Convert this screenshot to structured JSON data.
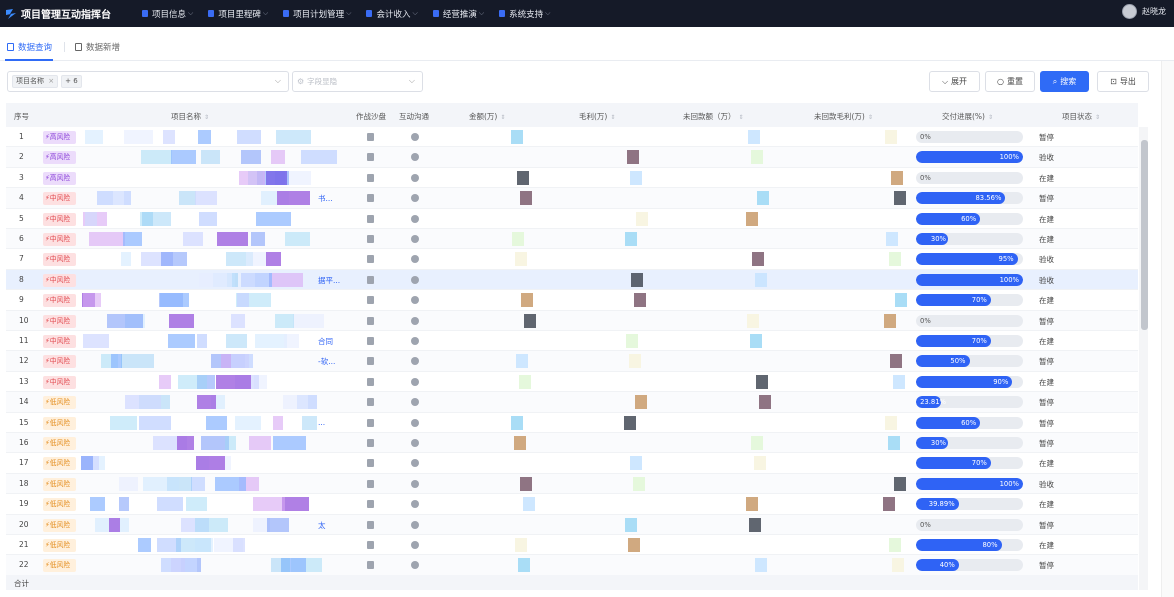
{
  "app": {
    "title": "项目管理互动指挥台"
  },
  "nav": [
    {
      "label": "项目信息"
    },
    {
      "label": "项目里程碑"
    },
    {
      "label": "项目计划管理"
    },
    {
      "label": "会计收入"
    },
    {
      "label": "经营推演"
    },
    {
      "label": "系统支持"
    }
  ],
  "user": {
    "name": "赵晓龙"
  },
  "tabs": [
    {
      "label": "数据查询"
    },
    {
      "label": "数据新增"
    }
  ],
  "filters": {
    "chip1": "项目名称",
    "chip_close": "×",
    "chip2": "+ 6",
    "field_placeholder": "字段显隐"
  },
  "buttons": {
    "expand": "展开",
    "reset": "重置",
    "search": "搜索",
    "export": "导出"
  },
  "columns": {
    "index": "序号",
    "name": "项目名称",
    "sandbox": "作战沙盘",
    "comm": "互动沟通",
    "amount": "金额(万)",
    "margin": "毛利(万)",
    "future_amount": "未回款额（万）",
    "future_margin": "未回款毛利(万)",
    "progress": "交付进展(%)",
    "status": "项目状态"
  },
  "rows": [
    {
      "index": "1",
      "risk": "高风险",
      "level": "high",
      "progress_label": "0%",
      "progress": 0,
      "status": "暂停",
      "name_suffix": ""
    },
    {
      "index": "2",
      "risk": "高风险",
      "level": "high",
      "progress_label": "100%",
      "progress": 100,
      "status": "验收",
      "name_suffix": ""
    },
    {
      "index": "3",
      "risk": "高风险",
      "level": "high",
      "progress_label": "0%",
      "progress": 0,
      "status": "在建",
      "name_suffix": ""
    },
    {
      "index": "4",
      "risk": "中风险",
      "level": "mid",
      "progress_label": "83.56%",
      "progress": 83.56,
      "status": "暂停",
      "name_suffix": "书..."
    },
    {
      "index": "5",
      "risk": "中风险",
      "level": "mid",
      "progress_label": "60%",
      "progress": 60,
      "status": "在建",
      "name_suffix": ""
    },
    {
      "index": "6",
      "risk": "中风险",
      "level": "mid",
      "progress_label": "30%",
      "progress": 30,
      "status": "在建",
      "name_suffix": ""
    },
    {
      "index": "7",
      "risk": "中风险",
      "level": "mid",
      "progress_label": "95%",
      "progress": 95,
      "status": "验收",
      "name_suffix": ""
    },
    {
      "index": "8",
      "risk": "中风险",
      "level": "mid",
      "progress_label": "100%",
      "progress": 100,
      "status": "验收",
      "name_suffix": "据平..."
    },
    {
      "index": "9",
      "risk": "中风险",
      "level": "mid",
      "progress_label": "70%",
      "progress": 70,
      "status": "在建",
      "name_suffix": ""
    },
    {
      "index": "10",
      "risk": "中风险",
      "level": "mid",
      "progress_label": "0%",
      "progress": 0,
      "status": "暂停",
      "name_suffix": ""
    },
    {
      "index": "11",
      "risk": "中风险",
      "level": "mid",
      "progress_label": "70%",
      "progress": 70,
      "status": "在建",
      "name_suffix": "合同"
    },
    {
      "index": "12",
      "risk": "中风险",
      "level": "mid",
      "progress_label": "50%",
      "progress": 50,
      "status": "暂停",
      "name_suffix": "-软..."
    },
    {
      "index": "13",
      "risk": "中风险",
      "level": "mid",
      "progress_label": "90%",
      "progress": 90,
      "status": "在建",
      "name_suffix": ""
    },
    {
      "index": "14",
      "risk": "低风险",
      "level": "low",
      "progress_label": "23.81%",
      "progress": 23.81,
      "status": "暂停",
      "name_suffix": ""
    },
    {
      "index": "15",
      "risk": "低风险",
      "level": "low",
      "progress_label": "60%",
      "progress": 60,
      "status": "暂停",
      "name_suffix": "..."
    },
    {
      "index": "16",
      "risk": "低风险",
      "level": "low",
      "progress_label": "30%",
      "progress": 30,
      "status": "暂停",
      "name_suffix": ""
    },
    {
      "index": "17",
      "risk": "低风险",
      "level": "low",
      "progress_label": "70%",
      "progress": 70,
      "status": "在建",
      "name_suffix": ""
    },
    {
      "index": "18",
      "risk": "低风险",
      "level": "low",
      "progress_label": "100%",
      "progress": 100,
      "status": "验收",
      "name_suffix": ""
    },
    {
      "index": "19",
      "risk": "低风险",
      "level": "low",
      "progress_label": "39.89%",
      "progress": 39.89,
      "status": "在建",
      "name_suffix": ""
    },
    {
      "index": "20",
      "risk": "低风险",
      "level": "low",
      "progress_label": "0%",
      "progress": 0,
      "status": "暂停",
      "name_suffix": "太"
    },
    {
      "index": "21",
      "risk": "低风险",
      "level": "low",
      "progress_label": "80%",
      "progress": 80,
      "status": "在建",
      "name_suffix": ""
    },
    {
      "index": "22",
      "risk": "低风险",
      "level": "low",
      "progress_label": "40%",
      "progress": 40,
      "status": "暂停",
      "name_suffix": ""
    }
  ],
  "footer": {
    "label": "合计"
  },
  "colors": {
    "accent": "#2f6bf6",
    "high_risk": "#8a40d8",
    "mid_risk": "#e1474d",
    "low_risk": "#e38b1a",
    "progress_fill": "#2f63f5"
  },
  "icons": {
    "logo": "app-logo-icon",
    "nav": "document-icon",
    "risk": "lightning-icon",
    "sandbox": "flag-icon",
    "comm": "chat-icon",
    "sort": "sort-icon",
    "reset": "refresh-icon",
    "search": "search-icon",
    "export": "export-icon",
    "expand": "chevron-down-icon"
  }
}
